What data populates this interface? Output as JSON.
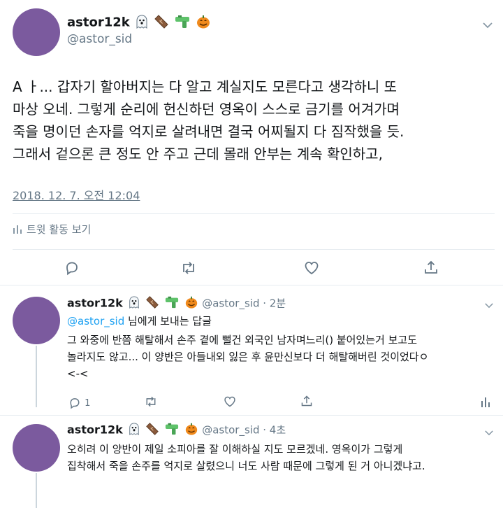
{
  "main_tweet": {
    "display_name": "astor12k",
    "handle": "@astor_sid",
    "emoji_icons": [
      "ghost-icon",
      "coffin-icon",
      "water-gun-icon",
      "jack-o-lantern-icon"
    ],
    "text_lines": [
      "A ㅏ... 갑자기 할아버지는 다 알고 계실지도 모른다고 생각하니 또",
      "마상 오네. 그렇게 순리에 헌신하던 영옥이 스스로 금기를 어겨가며",
      "죽을 명이던 손자를 억지로 살려내면 결국 어찌될지 다 짐작했을 듯.",
      "그래서 겉으론 큰 정도 안 주고 근데 몰래 안부는 계속 확인하고,"
    ],
    "timestamp": "2018. 12. 7. 오전 12:04",
    "activity_label": "트윗 활동 보기"
  },
  "replies": [
    {
      "display_name": "astor12k",
      "handle_time": "@astor_sid · 2분",
      "reply_to_handle": "@astor_sid",
      "reply_to_suffix": " 님에게 보내는 답글",
      "text_lines": [
        "그 와중에 반쯤 해탈해서 손주 곁에 뻘건 외국인 남자며느리() 붙어있는거 보고도",
        "놀라지도 않고... 이 양반은 아들내외 잃은 후 윤만신보다 더 해탈해버린 것이었다ㅇ",
        "<-<"
      ],
      "reply_count": "1"
    },
    {
      "display_name": "astor12k",
      "handle_time": "@astor_sid · 4초",
      "text_lines": [
        "오히려 이 양반이 제일 소피아를 잘 이해하실 지도 모르겠네. 영옥이가 그렇게",
        "집착해서 죽을 손주를 억지로 살렸으니 너도 사람 때문에 그렇게 된 거 아니겠냐고."
      ]
    }
  ]
}
